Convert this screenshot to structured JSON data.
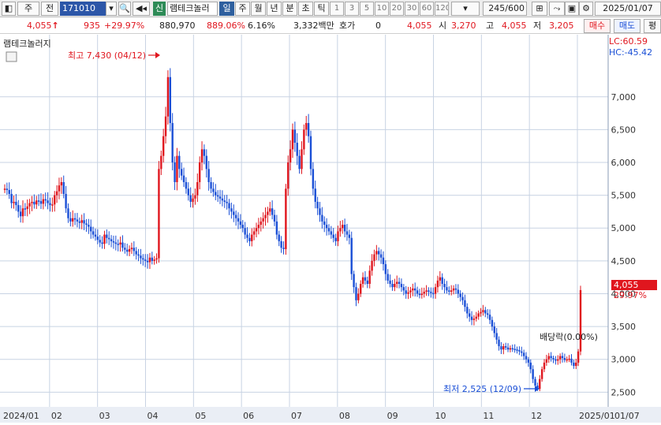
{
  "toolbar": {
    "period_select": "주",
    "prev_label": "전",
    "stock_code": "171010",
    "badge_sin": "신",
    "stock_name": "램테크놀러",
    "period_tabs": [
      "일",
      "주",
      "월",
      "년",
      "분",
      "초",
      "틱"
    ],
    "active_tab": "일",
    "interval_buttons": [
      "1",
      "3",
      "5",
      "10",
      "20",
      "30",
      "60",
      "120"
    ],
    "count": "245",
    "count_max": "/600",
    "date": "2025/01/07"
  },
  "quote": {
    "price": "4,055",
    "arrow": "↑",
    "change": "935",
    "change_pct": "+29.97%",
    "volume": "880,970",
    "volume_pct": "889.06%",
    "turnover": "6.16%",
    "amount": "3,332백만",
    "hoga_label": "호가",
    "hoga_value": "0",
    "current": "4,055",
    "open_label": "시",
    "open": "3,270",
    "high_label": "고",
    "high": "4,055",
    "low_label": "저",
    "low": "3,205",
    "buy_label": "매수",
    "sell_label": "매도",
    "avg_label": "평"
  },
  "chart_data": {
    "type": "candlestick",
    "title": "램테크놀러지",
    "lc_label": "LC:60.59",
    "hc_label": "HC:-45.42",
    "ylim": [
      2300,
      7850
    ],
    "y_ticks": [
      2500,
      3000,
      3500,
      4000,
      4500,
      5000,
      5500,
      6000,
      6500,
      7000
    ],
    "y_tick_labels": [
      "2,500",
      "3,000",
      "3,500",
      "4,000",
      "4,500",
      "5,000",
      "5,500",
      "6,000",
      "6,500",
      "7,000"
    ],
    "x_month_labels": [
      "2024/01",
      "02",
      "03",
      "04",
      "05",
      "06",
      "07",
      "08",
      "09",
      "10",
      "11",
      "12",
      "2025/01",
      "01/07"
    ],
    "max_annotation": "최고 7,430 (04/12)",
    "min_annotation": "최저 2,525 (12/09)",
    "dividend_annotation": "배당락(0.00%)",
    "last_price_label": "4,055",
    "last_change_label": "29.97%",
    "colors": {
      "up": "#e0161e",
      "down": "#1a4fd6",
      "grid": "#c8d3e3",
      "last_box": "#e0161e"
    },
    "closes": [
      5600,
      5580,
      5520,
      5380,
      5400,
      5350,
      5250,
      5180,
      5300,
      5290,
      5330,
      5380,
      5400,
      5360,
      5420,
      5410,
      5370,
      5440,
      5420,
      5380,
      5350,
      5360,
      5500,
      5560,
      5650,
      5700,
      5520,
      5300,
      5150,
      5100,
      5150,
      5130,
      5100,
      5080,
      5120,
      5070,
      5050,
      5020,
      4950,
      4900,
      4870,
      4820,
      4780,
      4760,
      4900,
      4850,
      4830,
      4800,
      4780,
      4760,
      4750,
      4780,
      4700,
      4670,
      4640,
      4680,
      4700,
      4650,
      4600,
      4580,
      4540,
      4520,
      4500,
      4480,
      4550,
      4500,
      4520,
      4540,
      5900,
      6100,
      6400,
      6700,
      7300,
      6600,
      6000,
      5700,
      6100,
      5900,
      5800,
      5700,
      5600,
      5500,
      5400,
      5450,
      5500,
      5700,
      6000,
      6200,
      6100,
      5900,
      5700,
      5600,
      5550,
      5500,
      5480,
      5450,
      5420,
      5400,
      5380,
      5300,
      5250,
      5200,
      5150,
      5100,
      5050,
      5000,
      4900,
      4850,
      4800,
      4900,
      4950,
      5000,
      5050,
      5100,
      5150,
      5200,
      5250,
      5300,
      5200,
      5100,
      4900,
      4800,
      4700,
      4680,
      5600,
      6000,
      6200,
      6500,
      6300,
      6100,
      5900,
      6200,
      6500,
      6600,
      6400,
      5900,
      5600,
      5400,
      5300,
      5200,
      5100,
      5050,
      5000,
      4950,
      4900,
      4850,
      4800,
      4950,
      5000,
      5050,
      4950,
      4900,
      4850,
      4300,
      4100,
      3900,
      4000,
      4150,
      4250,
      4200,
      4150,
      4350,
      4500,
      4600,
      4650,
      4600,
      4550,
      4450,
      4300,
      4200,
      4150,
      4100,
      4150,
      4180,
      4150,
      4100,
      4050,
      4000,
      4020,
      4050,
      4080,
      4050,
      4000,
      3980,
      4000,
      4030,
      4050,
      4030,
      4010,
      4000,
      4100,
      4200,
      4250,
      4150,
      4100,
      4050,
      4030,
      4050,
      4080,
      4060,
      4000,
      3950,
      3900,
      3800,
      3700,
      3650,
      3600,
      3620,
      3650,
      3700,
      3720,
      3750,
      3700,
      3680,
      3600,
      3500,
      3400,
      3300,
      3200,
      3150,
      3200,
      3180,
      3150,
      3170,
      3160,
      3150,
      3140,
      3120,
      3100,
      3050,
      3000,
      2950,
      2850,
      2700,
      2600,
      2550,
      2700,
      2850,
      2950,
      3000,
      3050,
      3020,
      3000,
      2980,
      3000,
      3050,
      3020,
      2990,
      3000,
      3010,
      2950,
      2900,
      2950,
      3120,
      4055
    ]
  }
}
